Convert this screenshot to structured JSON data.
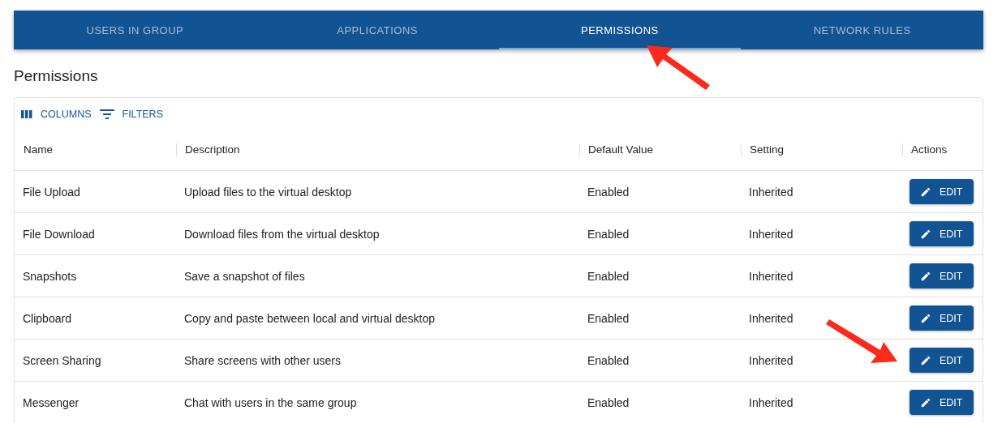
{
  "tabs": [
    {
      "label": "USERS IN GROUP",
      "selected": false
    },
    {
      "label": "APPLICATIONS",
      "selected": false
    },
    {
      "label": "PERMISSIONS",
      "selected": true
    },
    {
      "label": "NETWORK RULES",
      "selected": false
    }
  ],
  "heading": "Permissions",
  "toolbar": [
    {
      "label": "COLUMNS",
      "kind": "columns"
    },
    {
      "label": "FILTERS",
      "kind": "filters"
    }
  ],
  "table": {
    "columns": [
      "Name",
      "Description",
      "Default Value",
      "Setting",
      "Actions"
    ],
    "rows": [
      {
        "name": "File Upload",
        "description": "Upload files to the virtual desktop",
        "default_value": "Enabled",
        "setting": "Inherited",
        "action": "EDIT"
      },
      {
        "name": "File Download",
        "description": "Download files from the virtual desktop",
        "default_value": "Enabled",
        "setting": "Inherited",
        "action": "EDIT"
      },
      {
        "name": "Snapshots",
        "description": "Save a snapshot of files",
        "default_value": "Enabled",
        "setting": "Inherited",
        "action": "EDIT"
      },
      {
        "name": "Clipboard",
        "description": "Copy and paste between local and virtual desktop",
        "default_value": "Enabled",
        "setting": "Inherited",
        "action": "EDIT"
      },
      {
        "name": "Screen Sharing",
        "description": "Share screens with other users",
        "default_value": "Enabled",
        "setting": "Inherited",
        "action": "EDIT"
      },
      {
        "name": "Messenger",
        "description": "Chat with users in the same group",
        "default_value": "Enabled",
        "setting": "Inherited",
        "action": "EDIT"
      }
    ]
  }
}
